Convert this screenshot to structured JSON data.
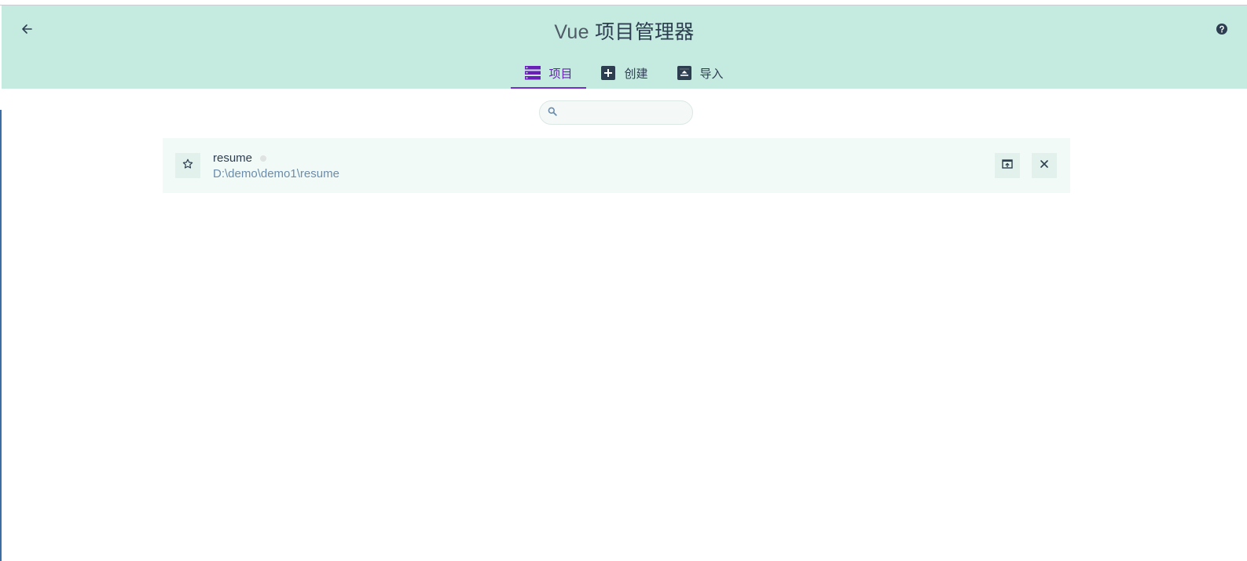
{
  "header": {
    "title_prefix": "Vue",
    "title_main": "项目管理器",
    "back_icon": "arrow-left-icon",
    "help_icon": "help-circle-icon"
  },
  "tabs": [
    {
      "label": "项目",
      "icon": "list-icon",
      "active": true
    },
    {
      "label": "创建",
      "icon": "plus-box-icon",
      "active": false
    },
    {
      "label": "导入",
      "icon": "import-box-icon",
      "active": false
    }
  ],
  "search": {
    "placeholder": "",
    "value": "",
    "icon": "search-icon"
  },
  "projects": [
    {
      "name": "resume",
      "path": "D:\\demo\\demo1\\resume",
      "favorite": false
    }
  ],
  "colors": {
    "header_bg": "#c5eae0",
    "accent": "#7b2bd1",
    "text": "#2c3e50",
    "path_text": "#6b8cab",
    "row_bg": "#f2faf8"
  }
}
